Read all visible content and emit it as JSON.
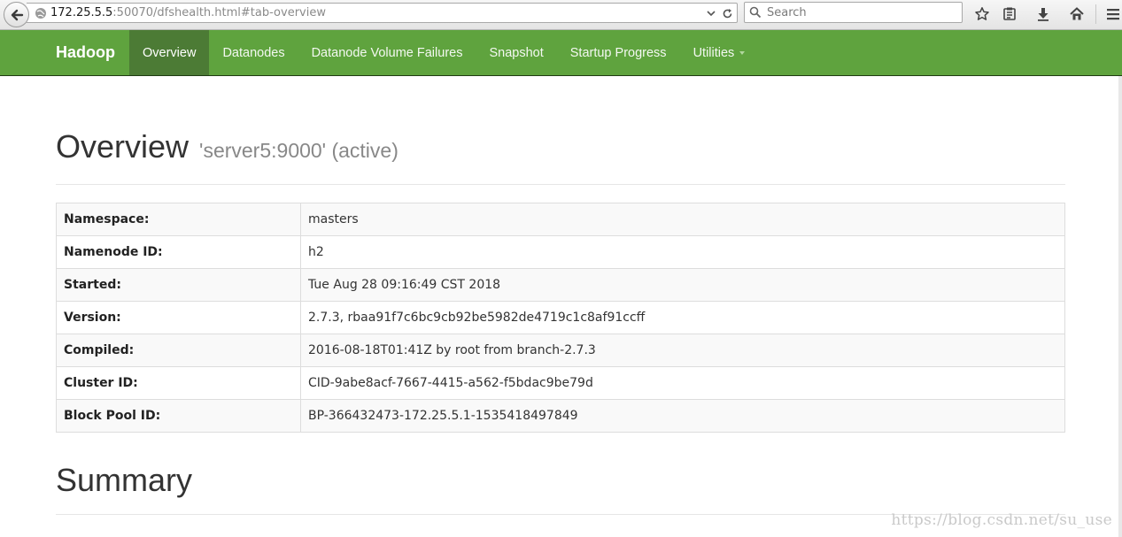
{
  "browser": {
    "url_host": "172.25.5.5",
    "url_path": ":50070/dfshealth.html#tab-overview",
    "search_placeholder": "Search"
  },
  "navbar": {
    "brand": "Hadoop",
    "items": [
      {
        "label": "Overview",
        "active": true
      },
      {
        "label": "Datanodes"
      },
      {
        "label": "Datanode Volume Failures"
      },
      {
        "label": "Snapshot"
      },
      {
        "label": "Startup Progress"
      },
      {
        "label": "Utilities",
        "dropdown": true
      }
    ]
  },
  "overview": {
    "title": "Overview",
    "subtitle": "'server5:9000' (active)",
    "rows": [
      {
        "key": "Namespace:",
        "value": "masters"
      },
      {
        "key": "Namenode ID:",
        "value": "h2"
      },
      {
        "key": "Started:",
        "value": "Tue Aug 28 09:16:49 CST 2018"
      },
      {
        "key": "Version:",
        "value": "2.7.3, rbaa91f7c6bc9cb92be5982de4719c1c8af91ccff"
      },
      {
        "key": "Compiled:",
        "value": "2016-08-18T01:41Z by root from branch-2.7.3"
      },
      {
        "key": "Cluster ID:",
        "value": "CID-9abe8acf-7667-4415-a562-f5bdac9be79d"
      },
      {
        "key": "Block Pool ID:",
        "value": "BP-366432473-172.25.5.1-1535418497849"
      }
    ]
  },
  "summary": {
    "title": "Summary"
  },
  "watermark": "https://blog.csdn.net/su_use",
  "colors": {
    "navbar": "#5fa33e",
    "navbar_active": "#4c7b35"
  }
}
